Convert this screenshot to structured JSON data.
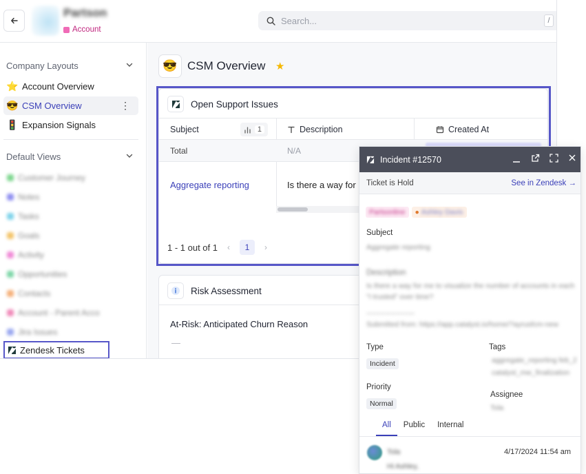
{
  "topbar": {
    "account_name": "Partson",
    "account_type": "Account",
    "search_placeholder": "Search...",
    "search_shortcut": "/"
  },
  "sidebar": {
    "company_layouts_header": "Company Layouts",
    "layouts": [
      {
        "emoji": "⭐",
        "label": "Account Overview"
      },
      {
        "emoji": "😎",
        "label": "CSM Overview"
      },
      {
        "emoji": "🚦",
        "label": "Expansion Signals"
      }
    ],
    "default_views_header": "Default Views",
    "default_views": [
      {
        "label": "Customer Journey",
        "color": "#7ed68f"
      },
      {
        "label": "Notes",
        "color": "#8f8ff0"
      },
      {
        "label": "Tasks",
        "color": "#7fd3ea"
      },
      {
        "label": "Goals",
        "color": "#f3c46a"
      },
      {
        "label": "Activity",
        "color": "#f08ad6"
      },
      {
        "label": "Opportunities",
        "color": "#7ed6a8"
      },
      {
        "label": "Contacts",
        "color": "#f5b07a"
      },
      {
        "label": "Account - Parent Acco",
        "color": "#f08ab9"
      },
      {
        "label": "Jira Issues",
        "color": "#9aa8f0"
      }
    ],
    "zendesk_label": "Zendesk Tickets"
  },
  "main": {
    "page_emoji": "😎",
    "page_title": "CSM Overview",
    "support": {
      "title": "Open Support Issues",
      "columns": {
        "subject": "Subject",
        "description": "Description",
        "created": "Created At"
      },
      "count": "1",
      "total_label": "Total",
      "total_desc": "N/A",
      "row": {
        "subject": "Aggregate reporting",
        "description": "Is there a way for"
      },
      "pagination": {
        "summary": "1 - 1 out of 1",
        "page": "1"
      }
    },
    "risk": {
      "title": "Risk Assessment",
      "field": "At-Risk: Anticipated Churn Reason",
      "value": "—"
    }
  },
  "popup": {
    "title": "Incident #12570",
    "status": "Ticket is Hold",
    "see_link": "See in Zendesk →",
    "tag_org": "Partsonline",
    "tag_person": "Ashley Davis",
    "subject_label": "Subject",
    "subject_value": "Aggregate reporting",
    "description_label": "Description",
    "description_value": "Is there a way for me to visualize the number of accounts in each \"I trusted\" over time?",
    "divider_text": "--------------------",
    "submitted": "Submitted from: https://app.catalyst.io/home/?ayrusfcm-new",
    "type_label": "Type",
    "type_value": "Incident",
    "tags_label": "Tags",
    "tags_value_1": "aggregate_reporting    feb_2",
    "tags_value_2": "catalyst_mw_finalization",
    "priority_label": "Priority",
    "priority_value": "Normal",
    "assignee_label": "Assignee",
    "assignee_value": "Tola",
    "tabs": [
      "All",
      "Public",
      "Internal"
    ],
    "comment_author": "Tola",
    "comment_time": "4/17/2024 11:54 am",
    "comment_text": "Hi Ashley,"
  }
}
